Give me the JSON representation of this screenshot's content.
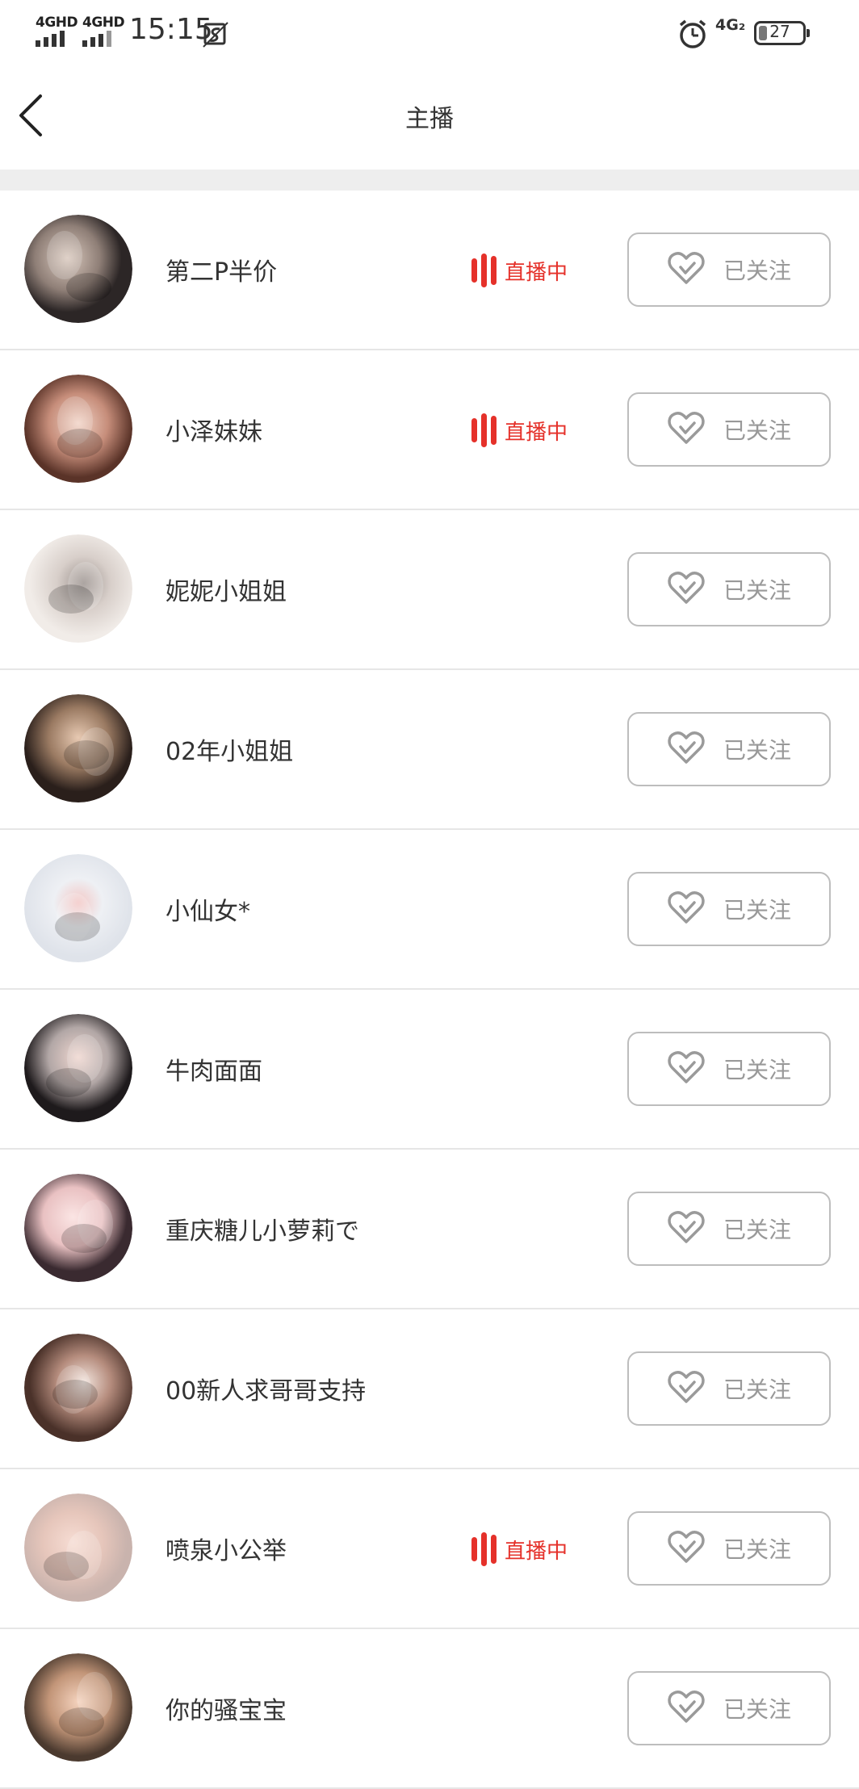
{
  "status_bar": {
    "signal1_label": "4GHD",
    "signal2_label": "4GHD",
    "time": "15:15",
    "network_label": "4G₂",
    "battery": "27"
  },
  "header": {
    "title": "主播"
  },
  "list": {
    "follow_label": "已关注",
    "live_label": "直播中",
    "items": [
      {
        "name": "第二P半价",
        "live": true
      },
      {
        "name": "小泽妹妹",
        "live": true
      },
      {
        "name": "妮妮小姐姐",
        "live": false
      },
      {
        "name": "02年小姐姐",
        "live": false
      },
      {
        "name": "小仙女*",
        "live": false
      },
      {
        "name": "牛肉面面",
        "live": false
      },
      {
        "name": "重庆糖儿小萝莉で",
        "live": false
      },
      {
        "name": "00新人求哥哥支持",
        "live": false
      },
      {
        "name": "喷泉小公举",
        "live": true
      },
      {
        "name": "你的骚宝宝",
        "live": false
      }
    ]
  },
  "colors": {
    "accent_live": "#e5312a",
    "follow_border": "#bdbdbd",
    "follow_text": "#999999",
    "divider": "#eeeeee"
  }
}
